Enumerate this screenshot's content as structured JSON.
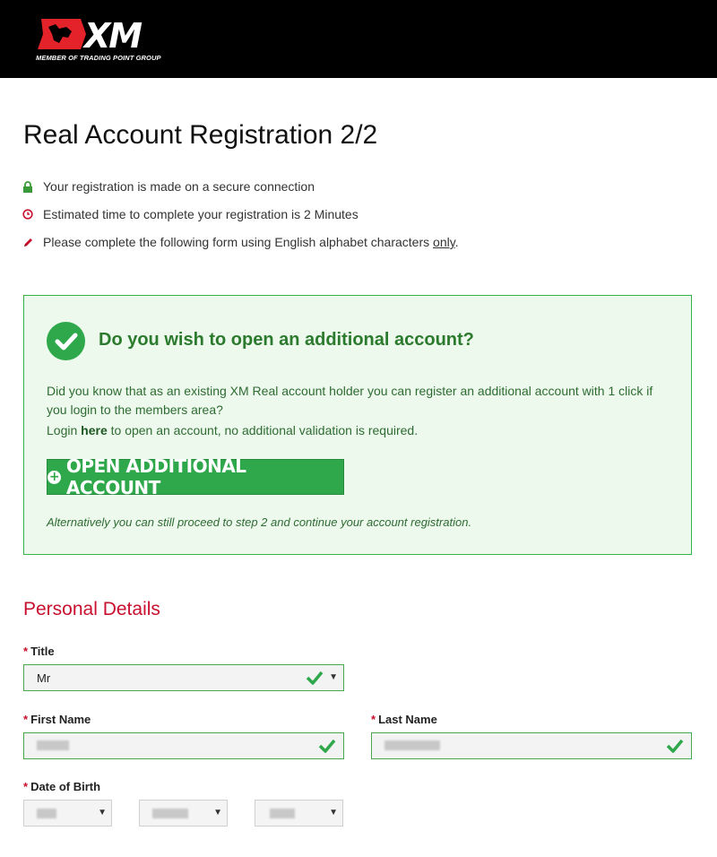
{
  "header": {
    "logo_text": "XM",
    "logo_tagline": "MEMBER OF TRADING POINT GROUP"
  },
  "page": {
    "title": "Real Account Registration 2/2"
  },
  "notes": [
    {
      "icon": "lock-icon",
      "text": "Your registration is made on a secure connection"
    },
    {
      "icon": "clock-icon",
      "text": "Estimated time to complete your registration is 2 Minutes"
    },
    {
      "icon": "pencil-icon",
      "text_before": "Please complete the following form using English alphabet characters ",
      "text_underlined": "only",
      "text_after": "."
    }
  ],
  "promo": {
    "title": "Do you wish to open an additional account?",
    "text": "Did you know that as an existing XM Real account holder you can register an additional account with 1 click if you login to the members area?",
    "login_before": "Login ",
    "login_link": "here",
    "login_after": " to open an account, no additional validation is required.",
    "button_label": "OPEN ADDITIONAL ACCOUNT",
    "alternative_text": "Alternatively you can still proceed to step 2 and continue your account registration."
  },
  "personal_details": {
    "section_title": "Personal Details",
    "required_marker": "*",
    "title_field": {
      "label": "Title",
      "value": "Mr"
    },
    "first_name_field": {
      "label": "First Name"
    },
    "last_name_field": {
      "label": "Last Name"
    },
    "dob_field": {
      "label": "Date of Birth"
    }
  },
  "colors": {
    "brand_red": "#c8102e",
    "success_green": "#2ea84a",
    "promo_bg": "#ecf9ec"
  }
}
